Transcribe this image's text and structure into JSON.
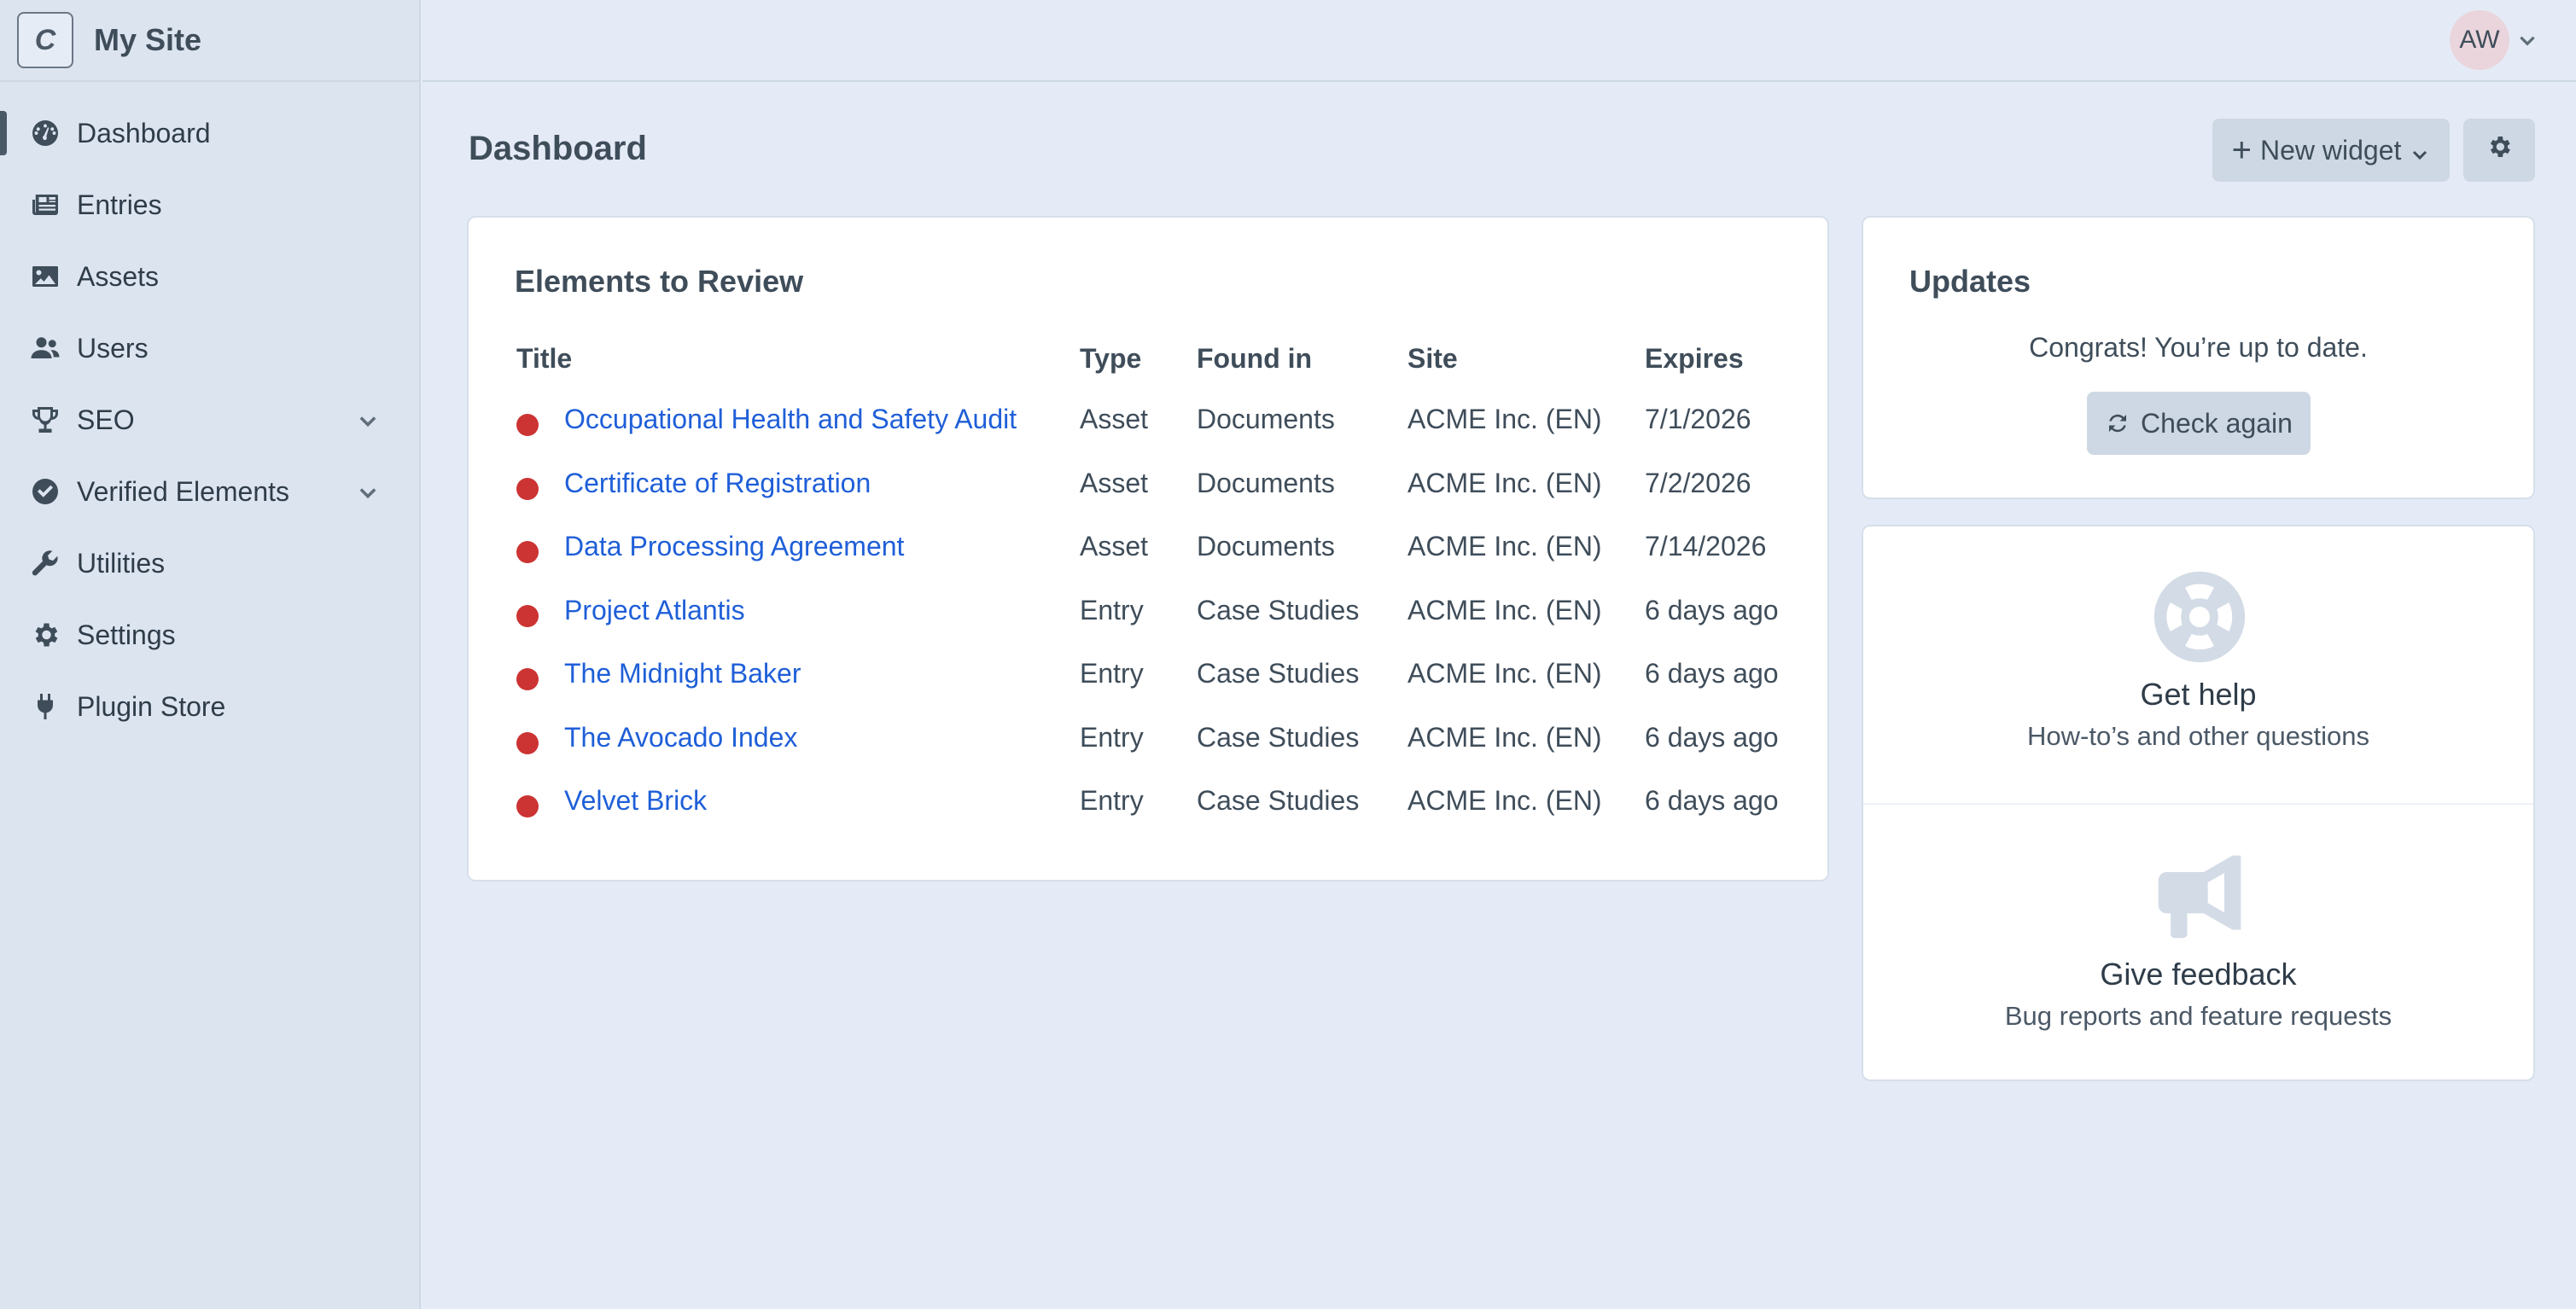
{
  "site": {
    "logo_letter": "C",
    "name": "My Site"
  },
  "sidebar": {
    "items": [
      {
        "label": "Dashboard",
        "icon": "gauge-icon",
        "active": true
      },
      {
        "label": "Entries",
        "icon": "newspaper-icon"
      },
      {
        "label": "Assets",
        "icon": "image-icon"
      },
      {
        "label": "Users",
        "icon": "users-icon"
      },
      {
        "label": "SEO",
        "icon": "trophy-icon",
        "expandable": true
      },
      {
        "label": "Verified Elements",
        "icon": "check-circle-icon",
        "expandable": true
      },
      {
        "label": "Utilities",
        "icon": "wrench-icon"
      },
      {
        "label": "Settings",
        "icon": "gear-icon"
      },
      {
        "label": "Plugin Store",
        "icon": "plug-icon"
      }
    ]
  },
  "user": {
    "initials": "AW"
  },
  "header": {
    "title": "Dashboard",
    "new_widget_label": "New widget"
  },
  "review": {
    "title": "Elements to Review",
    "columns": [
      "Title",
      "Type",
      "Found in",
      "Site",
      "Expires"
    ],
    "rows": [
      {
        "title": "Occupational Health and Safety Audit",
        "type": "Asset",
        "found_in": "Documents",
        "site": "ACME Inc. (EN)",
        "expires": "7/1/2026"
      },
      {
        "title": "Certificate of Registration",
        "type": "Asset",
        "found_in": "Documents",
        "site": "ACME Inc. (EN)",
        "expires": "7/2/2026"
      },
      {
        "title": "Data Processing Agreement",
        "type": "Asset",
        "found_in": "Documents",
        "site": "ACME Inc. (EN)",
        "expires": "7/14/2026"
      },
      {
        "title": "Project Atlantis",
        "type": "Entry",
        "found_in": "Case Studies",
        "site": "ACME Inc. (EN)",
        "expires": "6 days ago"
      },
      {
        "title": "The Midnight Baker",
        "type": "Entry",
        "found_in": "Case Studies",
        "site": "ACME Inc. (EN)",
        "expires": "6 days ago"
      },
      {
        "title": "The Avocado Index",
        "type": "Entry",
        "found_in": "Case Studies",
        "site": "ACME Inc. (EN)",
        "expires": "6 days ago"
      },
      {
        "title": "Velvet Brick",
        "type": "Entry",
        "found_in": "Case Studies",
        "site": "ACME Inc. (EN)",
        "expires": "6 days ago"
      }
    ],
    "status_color": "#cc3333"
  },
  "updates": {
    "title": "Updates",
    "message": "Congrats! You’re up to date.",
    "check_label": "Check again"
  },
  "help": {
    "get_help_title": "Get help",
    "get_help_sub": "How-to’s and other questions",
    "feedback_title": "Give feedback",
    "feedback_sub": "Bug reports and feature requests"
  },
  "colors": {
    "link": "#1f5fd8",
    "background": "#e4ebf6",
    "sidebar": "#dce4f0"
  }
}
